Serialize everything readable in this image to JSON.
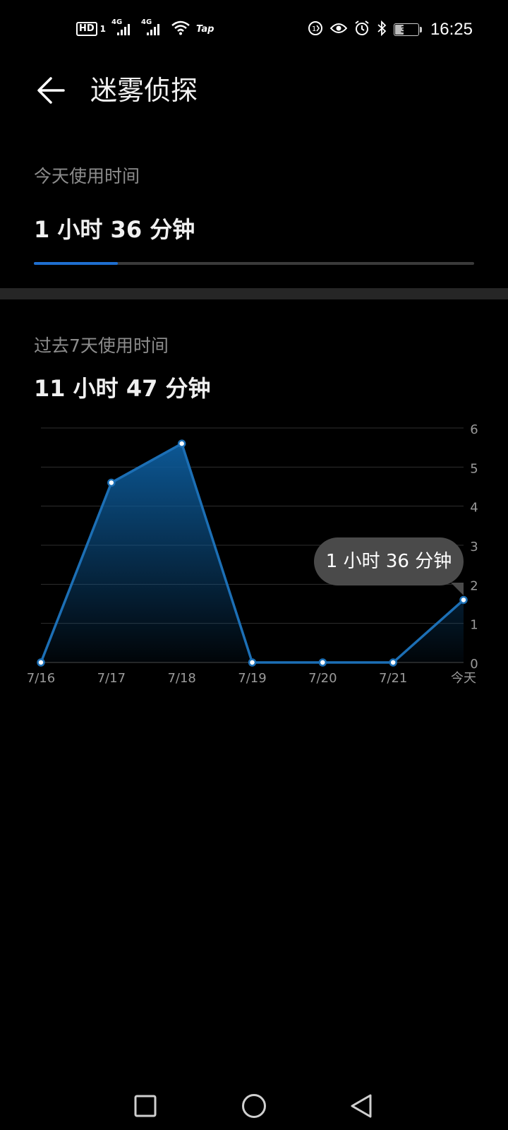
{
  "status_bar": {
    "hd": "HD",
    "sim1": "1",
    "net1": "4G",
    "net2": "4G",
    "tap": "Tap",
    "battery": "39",
    "battery_level": 0.39,
    "time": "16:25",
    "icons": [
      "hd-icon",
      "signal-icon",
      "signal-icon",
      "wifi-icon",
      "data-saver-icon",
      "eye-icon",
      "alarm-icon",
      "bluetooth-icon",
      "battery-icon"
    ]
  },
  "header": {
    "title": "迷雾侦探",
    "back_icon": "arrow-left-icon"
  },
  "today": {
    "label": "今天使用时间",
    "value": "1 小时 36 分钟",
    "progress": 0.19
  },
  "week": {
    "label": "过去7天使用时间",
    "value": "11 小时 47 分钟"
  },
  "chart_data": {
    "type": "area",
    "categories": [
      "7/16",
      "7/17",
      "7/18",
      "7/19",
      "7/20",
      "7/21",
      "今天"
    ],
    "values": [
      0,
      4.6,
      5.6,
      0,
      0,
      0,
      1.6
    ],
    "y_ticks": [
      "0",
      "1",
      "2",
      "3",
      "4",
      "5",
      "6"
    ],
    "ylim": [
      0,
      6
    ],
    "grid": true,
    "y_axis_side": "right",
    "line_color": "#1c6fb5",
    "fill_color": "#0c5fa0",
    "tooltip": {
      "text": "1 小时 36 分钟",
      "category": "今天"
    }
  },
  "nav_bar": {
    "icons": [
      "recent-apps-icon",
      "home-icon",
      "back-icon"
    ]
  }
}
